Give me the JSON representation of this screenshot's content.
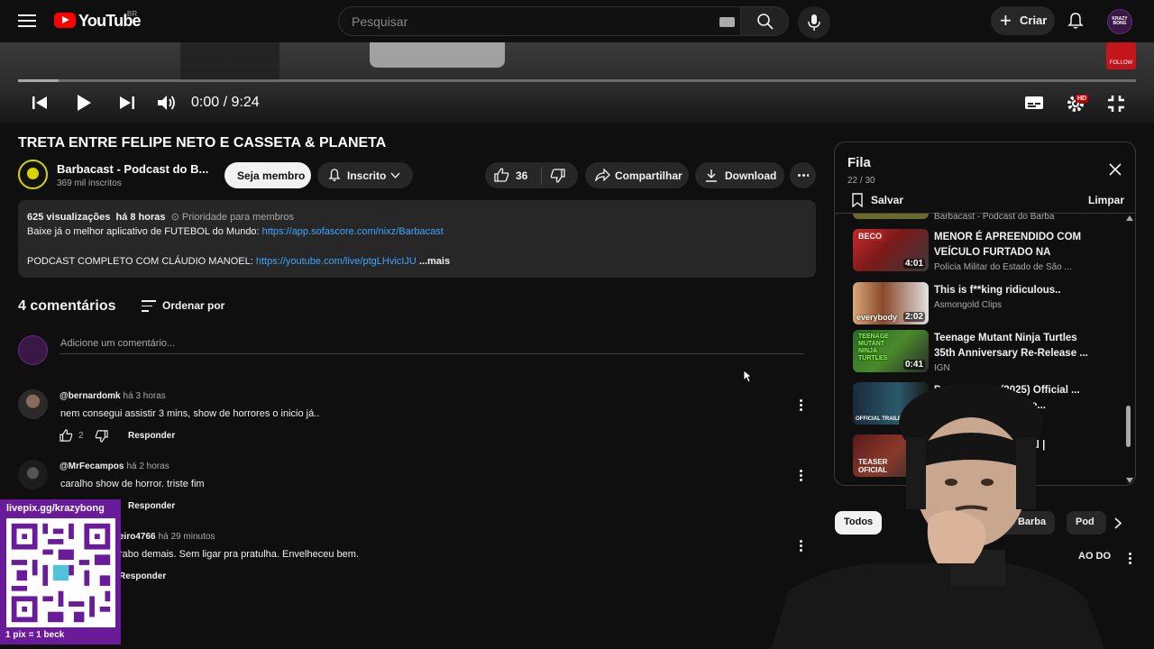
{
  "header": {
    "logo_text": "YouTube",
    "country": "BR",
    "search_placeholder": "Pesquisar",
    "create_label": "Criar",
    "avatar_text": "KRAZY BONG"
  },
  "player": {
    "time": "0:00 / 9:24",
    "progress": 0.036,
    "badge": "FOLLOW",
    "hd_badge": "HD"
  },
  "video": {
    "title": "TRETA ENTRE FELIPE NETO E CASSETA & PLANETA",
    "channel": "Barbacast - Podcast do B...",
    "subscribers": "369 mil inscritos",
    "join_label": "Seja membro",
    "subscribed_label": "Inscrito",
    "likes": "36",
    "share_label": "Compartilhar",
    "download_label": "Download"
  },
  "description": {
    "views": "625 visualizações",
    "ago": "há 8 horas",
    "priority": "Prioridade para membros",
    "line1_text": "Baixe já o melhor aplicativo de FUTEBOL do Mundo: ",
    "line1_link": "https://app.sofascore.com/nixz/Barbacast",
    "line2_text": "PODCAST COMPLETO COM CLÁUDIO MANOEL: ",
    "line2_link": "https://youtube.com/live/ptgLHvicIJU",
    "more": "...mais"
  },
  "comments": {
    "count_label": "4 comentários",
    "sort_label": "Ordenar por",
    "add_placeholder": "Adicione um comentário...",
    "reply_label": "Responder",
    "items": [
      {
        "author": "@bernardomk",
        "ago": "há 3 horas",
        "text": "nem consegui assistir 3 mins, show de horrores o inicio já..",
        "likes": "2"
      },
      {
        "author": "@MrFecampos",
        "ago": "há 2 horas",
        "text": "caralho show de horror. triste fim",
        "likes": ""
      },
      {
        "author": "eiro4766",
        "ago": "há 29 minutos",
        "text": "rabo demais. Sem ligar pra pratulha. Envelheceu bem.",
        "likes": ""
      }
    ]
  },
  "queue": {
    "title": "Fila",
    "count": "22 / 30",
    "save_label": "Salvar",
    "clear_label": "Limpar",
    "partial_channel": "Barbacast - Podcast do Barba",
    "items": [
      {
        "title": "MENOR É APREENDIDO COM VEÍCULO FURTADO NA ZONA...",
        "channel": "Polícia Militar do Estado de São ...",
        "duration": "4:01",
        "thumb_text": "BECO"
      },
      {
        "title": "This is f**king ridiculous..",
        "channel": "Asmongold Clips",
        "duration": "2:02",
        "thumb_text": "everybody"
      },
      {
        "title": "Teenage Mutant Ninja Turtles 35th Anniversary Re-Release ...",
        "channel": "IGN",
        "duration": "0:41",
        "thumb_text": "TEENAGE MUTANT NINJA TURTLES"
      },
      {
        "title": "Do Not Enter (2025) Official ... Jake Manley, Adeline...",
        "channel": "...",
        "duration": "",
        "thumb_text": "OFFICIAL TRAILER"
      },
      {
        "title": "...er oficial |",
        "channel": "",
        "duration": "",
        "thumb_text": "TEASER OFICIAL"
      }
    ]
  },
  "chips": {
    "items": [
      "Todos",
      "...o Barba",
      "Pod"
    ]
  },
  "related": {
    "partial_title": "AO DO"
  },
  "overlay": {
    "qr_top": "livepix.gg/krazybong",
    "qr_bottom": "1 pix = 1 beck"
  },
  "colors": {
    "background": "#0f0f0f",
    "accent_red": "#ff0000",
    "link": "#3ea6ff",
    "overlay_purple": "#6a1b9a"
  }
}
